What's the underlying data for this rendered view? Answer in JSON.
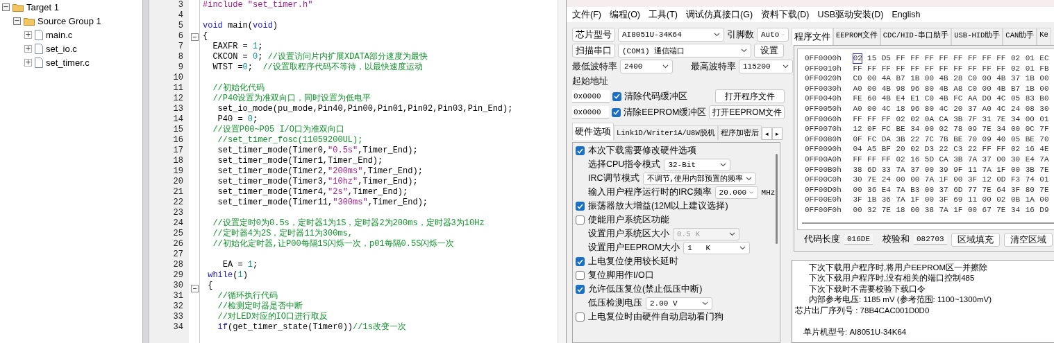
{
  "project_tree": [
    {
      "label": "Target 1",
      "toggle": "−",
      "expanded": true,
      "children": [
        {
          "label": "Source Group 1",
          "toggle": "−",
          "expanded": true,
          "children": [
            {
              "label": "main.c",
              "toggle": "+",
              "expanded": false
            },
            {
              "label": "set_io.c",
              "toggle": "+",
              "expanded": false
            },
            {
              "label": "set_timer.c",
              "toggle": "+",
              "expanded": false
            }
          ]
        }
      ]
    }
  ],
  "editor": {
    "lines": [
      {
        "number": "3",
        "fold": false,
        "segments": [
          {
            "kind": "preproc",
            "text": "#include \"set_timer.h\""
          }
        ]
      },
      {
        "number": "4",
        "fold": false
      },
      {
        "number": "5",
        "fold": false,
        "segments": [
          {
            "kind": "keyword",
            "text": "void"
          },
          {
            "kind": "plain",
            "text": " main("
          },
          {
            "kind": "keyword",
            "text": "void"
          },
          {
            "kind": "plain",
            "text": ")"
          }
        ]
      },
      {
        "number": "6",
        "fold": true,
        "segments": [
          {
            "kind": "plain",
            "text": "{"
          }
        ]
      },
      {
        "number": "7",
        "fold": false,
        "segments": [
          {
            "kind": "plain",
            "text": "  EAXFR = "
          },
          {
            "kind": "number",
            "text": "1"
          },
          {
            "kind": "plain",
            "text": ";"
          }
        ]
      },
      {
        "number": "8",
        "fold": false,
        "segments": [
          {
            "kind": "plain",
            "text": "  CKCON = "
          },
          {
            "kind": "number",
            "text": "0"
          },
          {
            "kind": "plain",
            "text": "; "
          },
          {
            "kind": "comment",
            "text": "//设置访问片内扩展XDATA部分速度为最快"
          }
        ]
      },
      {
        "number": "9",
        "fold": false,
        "segments": [
          {
            "kind": "plain",
            "text": "  WTST ="
          },
          {
            "kind": "number",
            "text": "0"
          },
          {
            "kind": "plain",
            "text": ";  "
          },
          {
            "kind": "comment",
            "text": "//设置取程序代码不等待，以最快速度运动"
          }
        ]
      },
      {
        "number": "10",
        "fold": false
      },
      {
        "number": "11",
        "fold": false,
        "segments": [
          {
            "kind": "comment",
            "text": "  //初始化代码"
          }
        ]
      },
      {
        "number": "12",
        "fold": false,
        "segments": [
          {
            "kind": "comment",
            "text": "  //P40设置为准双向口，同时设置为低电平"
          }
        ]
      },
      {
        "number": "13",
        "fold": false,
        "segments": [
          {
            "kind": "plain",
            "text": "   set_io_mode(pu_mode,Pin40,Pin00,Pin01,Pin02,Pin03,Pin_End);"
          }
        ]
      },
      {
        "number": "14",
        "fold": false,
        "segments": [
          {
            "kind": "plain",
            "text": "   P40 = "
          },
          {
            "kind": "number",
            "text": "0"
          },
          {
            "kind": "plain",
            "text": ";"
          }
        ]
      },
      {
        "number": "15",
        "fold": false,
        "segments": [
          {
            "kind": "comment",
            "text": "  //设置P00~P05 I/O口为准双向口"
          }
        ]
      },
      {
        "number": "16",
        "fold": false,
        "segments": [
          {
            "kind": "comment",
            "text": "   //set_timer_fosc(11059200UL);"
          }
        ]
      },
      {
        "number": "17",
        "fold": false,
        "segments": [
          {
            "kind": "plain",
            "text": "   set_timer_mode(Timer0,"
          },
          {
            "kind": "string",
            "text": "\"0.5s\""
          },
          {
            "kind": "plain",
            "text": ",Timer_End);"
          }
        ]
      },
      {
        "number": "18",
        "fold": false,
        "segments": [
          {
            "kind": "plain",
            "text": "   set_timer_mode(Timer1,Timer_End);"
          }
        ]
      },
      {
        "number": "19",
        "fold": false,
        "segments": [
          {
            "kind": "plain",
            "text": "   set_timer_mode(Timer2,"
          },
          {
            "kind": "string",
            "text": "\"200ms\""
          },
          {
            "kind": "plain",
            "text": ",Timer_End);"
          }
        ]
      },
      {
        "number": "20",
        "fold": false,
        "segments": [
          {
            "kind": "plain",
            "text": "   set_timer_mode(Timer3,"
          },
          {
            "kind": "string",
            "text": "\"10hz\""
          },
          {
            "kind": "plain",
            "text": ",Timer_End);"
          }
        ]
      },
      {
        "number": "21",
        "fold": false,
        "segments": [
          {
            "kind": "plain",
            "text": "   set_timer_mode(Timer4,"
          },
          {
            "kind": "string",
            "text": "\"2s\""
          },
          {
            "kind": "plain",
            "text": ",Timer_End);"
          }
        ]
      },
      {
        "number": "22",
        "fold": false,
        "segments": [
          {
            "kind": "plain",
            "text": "   set_timer_mode(Timer11,"
          },
          {
            "kind": "string",
            "text": "\"300ms\""
          },
          {
            "kind": "plain",
            "text": ",Timer_End);"
          }
        ]
      },
      {
        "number": "23",
        "fold": false
      },
      {
        "number": "24",
        "fold": false,
        "segments": [
          {
            "kind": "comment",
            "text": "  //设置定时0为0.5s，定时器1为1S，定时器2为200ms，定时器3为10Hz"
          }
        ]
      },
      {
        "number": "25",
        "fold": false,
        "segments": [
          {
            "kind": "comment",
            "text": "  //定时器4为2S，定时器11为300ms,"
          }
        ]
      },
      {
        "number": "26",
        "fold": false,
        "segments": [
          {
            "kind": "comment",
            "text": "  //初始化定时器,让P00每隔1S闪烁一次，p01每隔0.5S闪烁一次"
          }
        ]
      },
      {
        "number": "27",
        "fold": false
      },
      {
        "number": "28",
        "fold": false,
        "segments": [
          {
            "kind": "plain",
            "text": "    EA = "
          },
          {
            "kind": "number",
            "text": "1"
          },
          {
            "kind": "plain",
            "text": ";"
          }
        ]
      },
      {
        "number": "29",
        "fold": false,
        "segments": [
          {
            "kind": "keyword",
            "text": " while"
          },
          {
            "kind": "plain",
            "text": "("
          },
          {
            "kind": "number",
            "text": "1"
          },
          {
            "kind": "plain",
            "text": ")"
          }
        ]
      },
      {
        "number": "30",
        "fold": true,
        "segments": [
          {
            "kind": "plain",
            "text": " {"
          }
        ]
      },
      {
        "number": "31",
        "fold": false,
        "segments": [
          {
            "kind": "comment",
            "text": "   //循环执行代码"
          }
        ]
      },
      {
        "number": "32",
        "fold": false,
        "segments": [
          {
            "kind": "comment",
            "text": "   //检测定时器是否中断"
          }
        ]
      },
      {
        "number": "33",
        "fold": false,
        "segments": [
          {
            "kind": "comment",
            "text": "   //对LED对应的IO口进行取反"
          }
        ]
      },
      {
        "number": "34",
        "fold": false,
        "segments": [
          {
            "kind": "keyword",
            "text": "   if"
          },
          {
            "kind": "plain",
            "text": "(get_timer_state(Timer0))"
          },
          {
            "kind": "comment",
            "text": "//1s改变一次"
          }
        ]
      }
    ]
  },
  "isp": {
    "menu": [
      "文件(F)",
      "编程(O)",
      "工具(T)",
      "调试仿真接口(G)",
      "资料下载(D)",
      "USB驱动安装(D)",
      "English"
    ],
    "chip_button": "芯片型号",
    "chip_select": "AI8051U-34K64",
    "pins_label": "引脚数",
    "pins_select": "Auto",
    "scan_button": "扫描串口",
    "port_select": "(COM1) 通信端口",
    "settings_button": "设置",
    "min_baud_label": "最低波特率",
    "min_baud": "2400",
    "max_baud_label": "最高波特率",
    "max_baud": "115200",
    "start_address_label": "起始地址",
    "address_rows": [
      {
        "value": "0x0000",
        "checkbox": "清除代码缓冲区",
        "checked": true,
        "button": "打开程序文件"
      },
      {
        "value": "0x0000",
        "checkbox": "清除EEPROM缓冲区",
        "checked": true,
        "button": "打开EEPROM文件"
      }
    ],
    "left_tabs": [
      {
        "label": "硬件选项",
        "selected": true
      },
      {
        "label": "Link1D/Writer1A/U8W脱机",
        "selected": false
      },
      {
        "label": "程序加密后",
        "selected": false
      }
    ],
    "tab_scroll": [
      "◂",
      "▸"
    ],
    "options": [
      {
        "kind": "checkbox",
        "label": "本次下载需要修改硬件选项",
        "checked": true
      },
      {
        "kind": "select",
        "label": "选择CPU指令模式",
        "value": "32-Bit",
        "disabled": false
      },
      {
        "kind": "select",
        "label": "IRC调节模式",
        "value": "不调节,使用内部预置的频率",
        "disabled": false
      },
      {
        "kind": "select",
        "label": "输入用户程序运行时的IRC频率",
        "value": "20.000",
        "unit": "MHz",
        "disabled": false
      },
      {
        "kind": "checkbox",
        "label": "振荡器放大增益(12M以上建议选择)",
        "checked": true
      },
      {
        "kind": "checkbox",
        "label": "使能用户系统区功能",
        "checked": false
      },
      {
        "kind": "select",
        "label": "设置用户系统区大小",
        "value": "0.5 K",
        "disabled": true
      },
      {
        "kind": "select",
        "label": "设置用户EEPROM大小",
        "value": "1   K",
        "disabled": false
      },
      {
        "kind": "checkbox",
        "label": "上电复位使用较长延时",
        "checked": true
      },
      {
        "kind": "checkbox",
        "label": "复位脚用作I/O口",
        "checked": false
      },
      {
        "kind": "checkbox",
        "label": "允许低压复位(禁止低压中断)",
        "checked": true
      },
      {
        "kind": "select",
        "label": "低压检测电压",
        "value": "2.00 V",
        "disabled": false
      },
      {
        "kind": "checkbox",
        "label": "上电复位时由硬件自动启动看门狗",
        "checked": false
      }
    ],
    "right_tabs": [
      {
        "label": "程序文件",
        "selected": true
      },
      {
        "label": "EEPROM文件",
        "selected": false
      },
      {
        "label": "CDC/HID-串口助手",
        "selected": false
      },
      {
        "label": "USB-HID助手",
        "selected": false
      },
      {
        "label": "CAN助手",
        "selected": false
      },
      {
        "label": "Ke",
        "selected": false
      }
    ],
    "hex": {
      "cursor_at_start": true,
      "rows": [
        {
          "address": "0FF0000h",
          "bytes": [
            "02",
            "15",
            "D5",
            "FF",
            "FF",
            "FF",
            "FF",
            "FF",
            "FF",
            "FF",
            "FF",
            "02",
            "01",
            "EC"
          ]
        },
        {
          "address": "0FF0010h",
          "bytes": [
            "FF",
            "FF",
            "FF",
            "FF",
            "FF",
            "FF",
            "FF",
            "FF",
            "FF",
            "FF",
            "FF",
            "02",
            "01",
            "FB"
          ]
        },
        {
          "address": "0FF0020h",
          "bytes": [
            "C0",
            "00",
            "4A",
            "B7",
            "1B",
            "00",
            "4B",
            "28",
            "C0",
            "00",
            "4B",
            "37",
            "1B",
            "00"
          ]
        },
        {
          "address": "0FF0030h",
          "bytes": [
            "A0",
            "00",
            "4B",
            "98",
            "96",
            "80",
            "4B",
            "A8",
            "C0",
            "00",
            "4B",
            "B7",
            "1B",
            "00"
          ]
        },
        {
          "address": "0FF0040h",
          "bytes": [
            "FE",
            "60",
            "4B",
            "E4",
            "E1",
            "C0",
            "4B",
            "FC",
            "AA",
            "D0",
            "4C",
            "05",
            "83",
            "B0"
          ]
        },
        {
          "address": "0FF0050h",
          "bytes": [
            "A0",
            "00",
            "4C",
            "18",
            "96",
            "80",
            "4C",
            "20",
            "37",
            "A0",
            "4C",
            "24",
            "08",
            "30"
          ]
        },
        {
          "address": "0FF0060h",
          "bytes": [
            "FF",
            "FF",
            "FF",
            "02",
            "02",
            "0A",
            "CA",
            "3B",
            "7F",
            "31",
            "7E",
            "34",
            "00",
            "01"
          ]
        },
        {
          "address": "0FF0070h",
          "bytes": [
            "12",
            "0F",
            "FC",
            "BE",
            "34",
            "00",
            "02",
            "78",
            "09",
            "7E",
            "34",
            "00",
            "0C",
            "7F"
          ]
        },
        {
          "address": "0FF0080h",
          "bytes": [
            "0F",
            "FC",
            "DA",
            "3B",
            "22",
            "7C",
            "7B",
            "BE",
            "70",
            "09",
            "40",
            "05",
            "BE",
            "70"
          ]
        },
        {
          "address": "0FF0090h",
          "bytes": [
            "04",
            "A5",
            "BF",
            "20",
            "02",
            "D3",
            "22",
            "C3",
            "22",
            "FF",
            "FF",
            "02",
            "16",
            "4E"
          ]
        },
        {
          "address": "0FF00A0h",
          "bytes": [
            "FF",
            "FF",
            "FF",
            "02",
            "16",
            "5D",
            "CA",
            "3B",
            "7A",
            "37",
            "00",
            "30",
            "E4",
            "7A"
          ]
        },
        {
          "address": "0FF00B0h",
          "bytes": [
            "38",
            "6D",
            "33",
            "7A",
            "37",
            "00",
            "39",
            "9F",
            "11",
            "7A",
            "1F",
            "00",
            "3B",
            "7E"
          ]
        },
        {
          "address": "0FF00C0h",
          "bytes": [
            "30",
            "7E",
            "24",
            "00",
            "00",
            "7A",
            "1F",
            "00",
            "3F",
            "12",
            "0D",
            "F3",
            "74",
            "01"
          ]
        },
        {
          "address": "0FF00D0h",
          "bytes": [
            "00",
            "36",
            "E4",
            "7A",
            "B3",
            "00",
            "37",
            "6D",
            "77",
            "7E",
            "64",
            "3F",
            "80",
            "7E"
          ]
        },
        {
          "address": "0FF00E0h",
          "bytes": [
            "3F",
            "1B",
            "36",
            "7A",
            "1F",
            "00",
            "3F",
            "69",
            "11",
            "00",
            "02",
            "0B",
            "1A",
            "00"
          ]
        },
        {
          "address": "0FF00F0h",
          "bytes": [
            "00",
            "32",
            "7E",
            "18",
            "00",
            "38",
            "7A",
            "1F",
            "00",
            "67",
            "7E",
            "34",
            "16",
            "D9"
          ]
        }
      ]
    },
    "code_length_label": "代码长度",
    "code_length": "016DE",
    "checksum_label": "校验和",
    "checksum": "082703",
    "buttons": [
      "区域填充",
      "清空区域"
    ],
    "log": [
      {
        "kind": "note",
        "text": "下次下载用户程序时,将用户EEPROM区一并擦除"
      },
      {
        "kind": "note",
        "text": "下次下载用户程序时,没有相关的端口控制485"
      },
      {
        "kind": "note",
        "text": "下次下载时不需要校验下载口令"
      },
      {
        "kind": "note",
        "text": "内部参考电压: 1185 mV (参考范围: 1100~1300mV)"
      },
      {
        "kind": "info",
        "text": "芯片出厂序列号 : 78B4CAC001D0D0"
      },
      {
        "kind": "blank"
      },
      {
        "kind": "indented",
        "text": "单片机型号: AI8051U-34K64"
      }
    ]
  }
}
